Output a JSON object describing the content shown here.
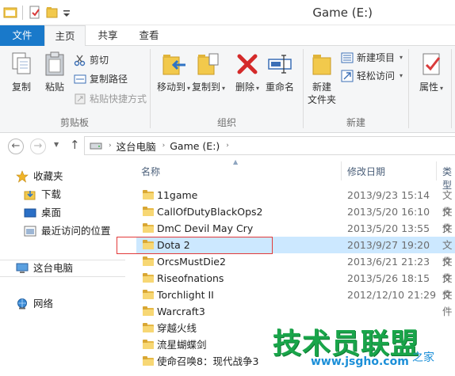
{
  "window": {
    "title": "Game (E:)"
  },
  "tabs": [
    {
      "label": "文件"
    },
    {
      "label": "主页"
    },
    {
      "label": "共享"
    },
    {
      "label": "查看"
    }
  ],
  "ribbon": {
    "clipboard": {
      "copy": "复制",
      "paste": "粘贴",
      "cut": "剪切",
      "copy_path": "复制路径",
      "paste_shortcut": "粘贴快捷方式",
      "group": "剪贴板"
    },
    "organize": {
      "move_to": "移动到",
      "copy_to": "复制到",
      "delete": "删除",
      "rename": "重命名",
      "group": "组织"
    },
    "new": {
      "new_folder_line1": "新建",
      "new_folder_line2": "文件夹",
      "new_item": "新建项目",
      "easy_access": "轻松访问",
      "group": "新建"
    },
    "open": {
      "properties": "属性"
    }
  },
  "address": {
    "crumbs": [
      "这台电脑",
      "Game (E:)"
    ]
  },
  "nav_pane": {
    "favorites": "收藏夹",
    "items": [
      "下载",
      "桌面",
      "最近访问的位置"
    ],
    "this_pc": "这台电脑",
    "network": "网络"
  },
  "columns": {
    "name": "名称",
    "date": "修改日期",
    "type": "类型"
  },
  "files": [
    {
      "name": "11game",
      "date": "2013/9/23 15:14",
      "type": "文件"
    },
    {
      "name": "CallOfDutyBlackOps2",
      "date": "2013/5/20 16:10",
      "type": "文件"
    },
    {
      "name": "DmC Devil May Cry",
      "date": "2013/5/20 13:55",
      "type": "文件"
    },
    {
      "name": "Dota 2",
      "date": "2013/9/27 19:20",
      "type": "文件"
    },
    {
      "name": "OrcsMustDie2",
      "date": "2013/6/21 21:23",
      "type": "文件"
    },
    {
      "name": "Riseofnations",
      "date": "2013/5/26 18:15",
      "type": "文件"
    },
    {
      "name": "Torchlight II",
      "date": "2012/12/10 21:29",
      "type": "文件"
    },
    {
      "name": "Warcraft3",
      "date": "",
      "type": ""
    },
    {
      "name": "穿越火线",
      "date": "",
      "type": ""
    },
    {
      "name": "流星蝴蝶剑",
      "date": "",
      "type": ""
    },
    {
      "name": "使命召唤8：现代战争3",
      "date": "",
      "type": ""
    }
  ],
  "watermark": {
    "main": "技术员联盟",
    "url": "www.jsgho.com",
    "tag": "之家"
  },
  "colors": {
    "accent": "#1979ca",
    "selection": "#cce8ff",
    "highlight_border": "#e23a3a",
    "folder": "#f7d774",
    "watermark_green": "#19a54a"
  }
}
